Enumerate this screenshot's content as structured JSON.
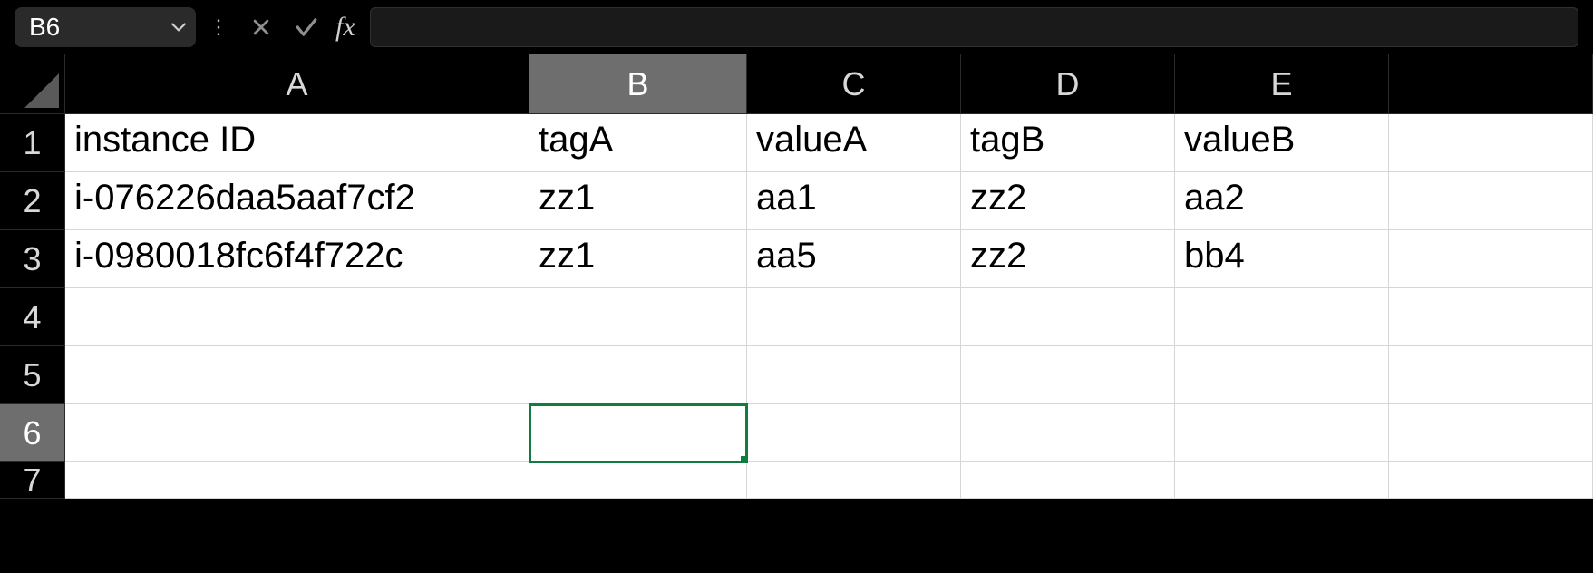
{
  "name_box": "B6",
  "formula_value": "",
  "columns": [
    "A",
    "B",
    "C",
    "D",
    "E"
  ],
  "row_numbers": [
    "1",
    "2",
    "3",
    "4",
    "5",
    "6",
    "7"
  ],
  "active_col_index": 1,
  "active_row_index": 5,
  "selected_cell": "B6",
  "grid": [
    [
      "instance ID",
      "tagA",
      "valueA",
      "tagB",
      "valueB",
      ""
    ],
    [
      "i-076226daa5aaf7cf2",
      "zz1",
      "aa1",
      "zz2",
      "aa2",
      ""
    ],
    [
      "i-0980018fc6f4f722c",
      "zz1",
      "aa5",
      "zz2",
      "bb4",
      ""
    ],
    [
      "",
      "",
      "",
      "",
      "",
      ""
    ],
    [
      "",
      "",
      "",
      "",
      "",
      ""
    ],
    [
      "",
      "",
      "",
      "",
      "",
      ""
    ],
    [
      "",
      "",
      "",
      "",
      "",
      ""
    ]
  ]
}
